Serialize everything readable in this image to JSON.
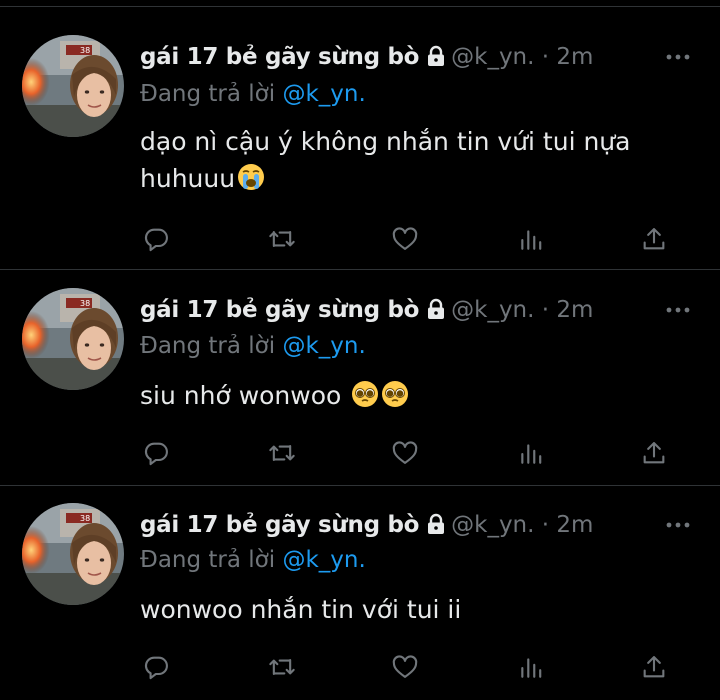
{
  "tweets": [
    {
      "display_name": "gái 17 bẻ gãy sừng bò",
      "handle": "@k_yn.",
      "dot": "·",
      "time": "2m",
      "reply_prefix": "Đang trả lời",
      "reply_handle": "@k_yn.",
      "text_line1": "dạo nì cậu ý không nhắn tin vứi tui nựa",
      "text_line2": "huhuuu",
      "emoji": [
        "loudly-crying-face"
      ]
    },
    {
      "display_name": "gái 17 bẻ gãy sừng bò",
      "handle": "@k_yn.",
      "dot": "·",
      "time": "2m",
      "reply_prefix": "Đang trả lời",
      "reply_handle": "@k_yn.",
      "text_line1": "siu nhớ wonwoo",
      "emoji": [
        "pleading-face",
        "pleading-face"
      ]
    },
    {
      "display_name": "gái 17 bẻ gãy sừng bò",
      "handle": "@k_yn.",
      "dot": "·",
      "time": "2m",
      "reply_prefix": "Đang trả lời",
      "reply_handle": "@k_yn.",
      "text_line1": "wonwoo nhắn tin với tui ii"
    }
  ],
  "icons": {
    "reply": "reply-icon",
    "retweet": "retweet-icon",
    "like": "heart-icon",
    "views": "views-icon",
    "share": "share-icon",
    "more": "more-icon",
    "lock": "lock-icon"
  },
  "colors": {
    "background": "#000000",
    "text": "#e7e9ea",
    "muted": "#71767b",
    "link": "#1d9bf0",
    "divider": "#2f3336"
  }
}
